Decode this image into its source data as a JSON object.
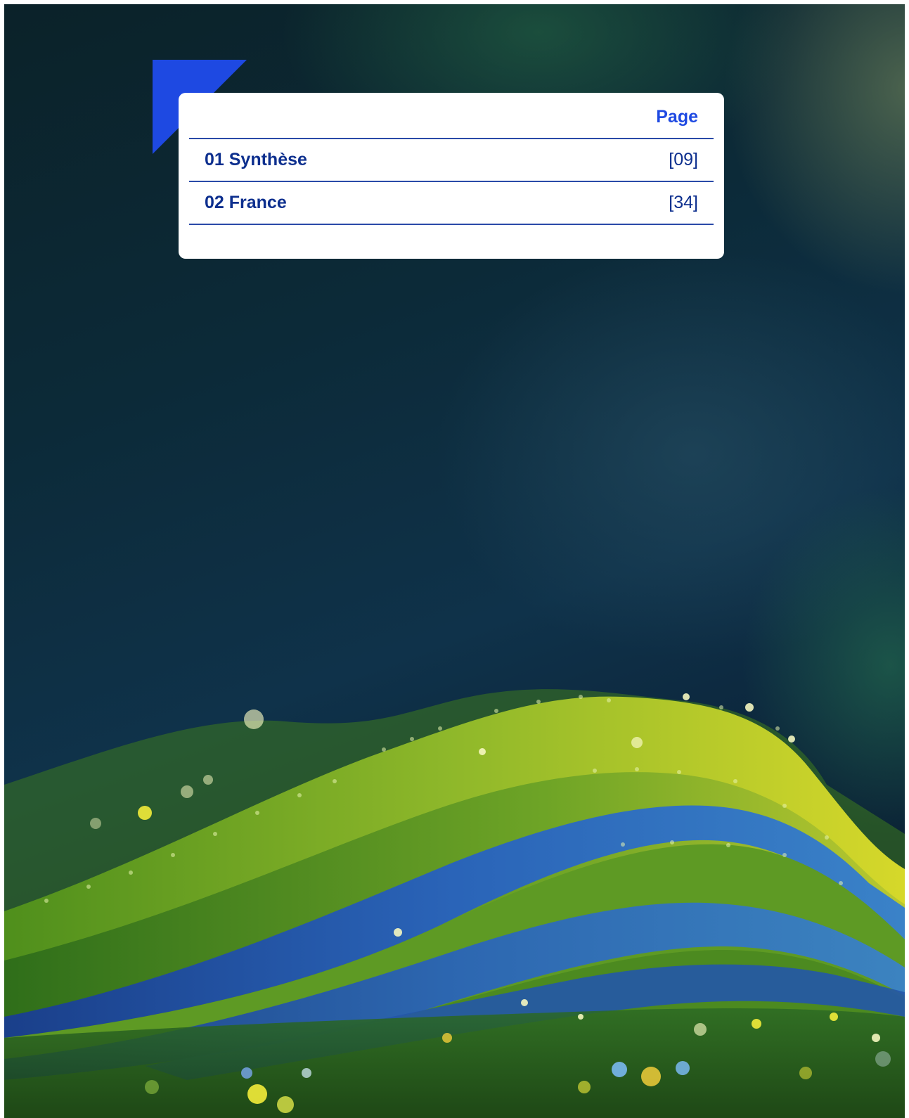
{
  "toc": {
    "header_label": "Page",
    "entries": [
      {
        "title": "01 Synthèse",
        "page": "[09]"
      },
      {
        "title": "02 France",
        "page": "[34]"
      }
    ]
  },
  "colors": {
    "accent_blue": "#1e49e2",
    "text_navy": "#0d2f8e",
    "rule_blue": "#2a4aa8",
    "card_background": "#ffffff"
  }
}
